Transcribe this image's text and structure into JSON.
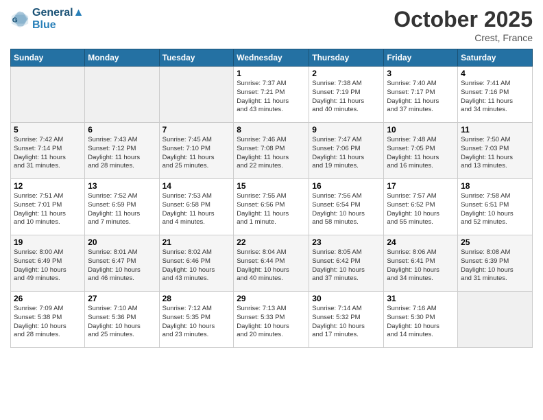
{
  "logo": {
    "line1": "General",
    "line2": "Blue"
  },
  "title": "October 2025",
  "subtitle": "Crest, France",
  "days_header": [
    "Sunday",
    "Monday",
    "Tuesday",
    "Wednesday",
    "Thursday",
    "Friday",
    "Saturday"
  ],
  "weeks": [
    [
      {
        "day": "",
        "info": ""
      },
      {
        "day": "",
        "info": ""
      },
      {
        "day": "",
        "info": ""
      },
      {
        "day": "1",
        "info": "Sunrise: 7:37 AM\nSunset: 7:21 PM\nDaylight: 11 hours\nand 43 minutes."
      },
      {
        "day": "2",
        "info": "Sunrise: 7:38 AM\nSunset: 7:19 PM\nDaylight: 11 hours\nand 40 minutes."
      },
      {
        "day": "3",
        "info": "Sunrise: 7:40 AM\nSunset: 7:17 PM\nDaylight: 11 hours\nand 37 minutes."
      },
      {
        "day": "4",
        "info": "Sunrise: 7:41 AM\nSunset: 7:16 PM\nDaylight: 11 hours\nand 34 minutes."
      }
    ],
    [
      {
        "day": "5",
        "info": "Sunrise: 7:42 AM\nSunset: 7:14 PM\nDaylight: 11 hours\nand 31 minutes."
      },
      {
        "day": "6",
        "info": "Sunrise: 7:43 AM\nSunset: 7:12 PM\nDaylight: 11 hours\nand 28 minutes."
      },
      {
        "day": "7",
        "info": "Sunrise: 7:45 AM\nSunset: 7:10 PM\nDaylight: 11 hours\nand 25 minutes."
      },
      {
        "day": "8",
        "info": "Sunrise: 7:46 AM\nSunset: 7:08 PM\nDaylight: 11 hours\nand 22 minutes."
      },
      {
        "day": "9",
        "info": "Sunrise: 7:47 AM\nSunset: 7:06 PM\nDaylight: 11 hours\nand 19 minutes."
      },
      {
        "day": "10",
        "info": "Sunrise: 7:48 AM\nSunset: 7:05 PM\nDaylight: 11 hours\nand 16 minutes."
      },
      {
        "day": "11",
        "info": "Sunrise: 7:50 AM\nSunset: 7:03 PM\nDaylight: 11 hours\nand 13 minutes."
      }
    ],
    [
      {
        "day": "12",
        "info": "Sunrise: 7:51 AM\nSunset: 7:01 PM\nDaylight: 11 hours\nand 10 minutes."
      },
      {
        "day": "13",
        "info": "Sunrise: 7:52 AM\nSunset: 6:59 PM\nDaylight: 11 hours\nand 7 minutes."
      },
      {
        "day": "14",
        "info": "Sunrise: 7:53 AM\nSunset: 6:58 PM\nDaylight: 11 hours\nand 4 minutes."
      },
      {
        "day": "15",
        "info": "Sunrise: 7:55 AM\nSunset: 6:56 PM\nDaylight: 11 hours\nand 1 minute."
      },
      {
        "day": "16",
        "info": "Sunrise: 7:56 AM\nSunset: 6:54 PM\nDaylight: 10 hours\nand 58 minutes."
      },
      {
        "day": "17",
        "info": "Sunrise: 7:57 AM\nSunset: 6:52 PM\nDaylight: 10 hours\nand 55 minutes."
      },
      {
        "day": "18",
        "info": "Sunrise: 7:58 AM\nSunset: 6:51 PM\nDaylight: 10 hours\nand 52 minutes."
      }
    ],
    [
      {
        "day": "19",
        "info": "Sunrise: 8:00 AM\nSunset: 6:49 PM\nDaylight: 10 hours\nand 49 minutes."
      },
      {
        "day": "20",
        "info": "Sunrise: 8:01 AM\nSunset: 6:47 PM\nDaylight: 10 hours\nand 46 minutes."
      },
      {
        "day": "21",
        "info": "Sunrise: 8:02 AM\nSunset: 6:46 PM\nDaylight: 10 hours\nand 43 minutes."
      },
      {
        "day": "22",
        "info": "Sunrise: 8:04 AM\nSunset: 6:44 PM\nDaylight: 10 hours\nand 40 minutes."
      },
      {
        "day": "23",
        "info": "Sunrise: 8:05 AM\nSunset: 6:42 PM\nDaylight: 10 hours\nand 37 minutes."
      },
      {
        "day": "24",
        "info": "Sunrise: 8:06 AM\nSunset: 6:41 PM\nDaylight: 10 hours\nand 34 minutes."
      },
      {
        "day": "25",
        "info": "Sunrise: 8:08 AM\nSunset: 6:39 PM\nDaylight: 10 hours\nand 31 minutes."
      }
    ],
    [
      {
        "day": "26",
        "info": "Sunrise: 7:09 AM\nSunset: 5:38 PM\nDaylight: 10 hours\nand 28 minutes."
      },
      {
        "day": "27",
        "info": "Sunrise: 7:10 AM\nSunset: 5:36 PM\nDaylight: 10 hours\nand 25 minutes."
      },
      {
        "day": "28",
        "info": "Sunrise: 7:12 AM\nSunset: 5:35 PM\nDaylight: 10 hours\nand 23 minutes."
      },
      {
        "day": "29",
        "info": "Sunrise: 7:13 AM\nSunset: 5:33 PM\nDaylight: 10 hours\nand 20 minutes."
      },
      {
        "day": "30",
        "info": "Sunrise: 7:14 AM\nSunset: 5:32 PM\nDaylight: 10 hours\nand 17 minutes."
      },
      {
        "day": "31",
        "info": "Sunrise: 7:16 AM\nSunset: 5:30 PM\nDaylight: 10 hours\nand 14 minutes."
      },
      {
        "day": "",
        "info": ""
      }
    ]
  ]
}
